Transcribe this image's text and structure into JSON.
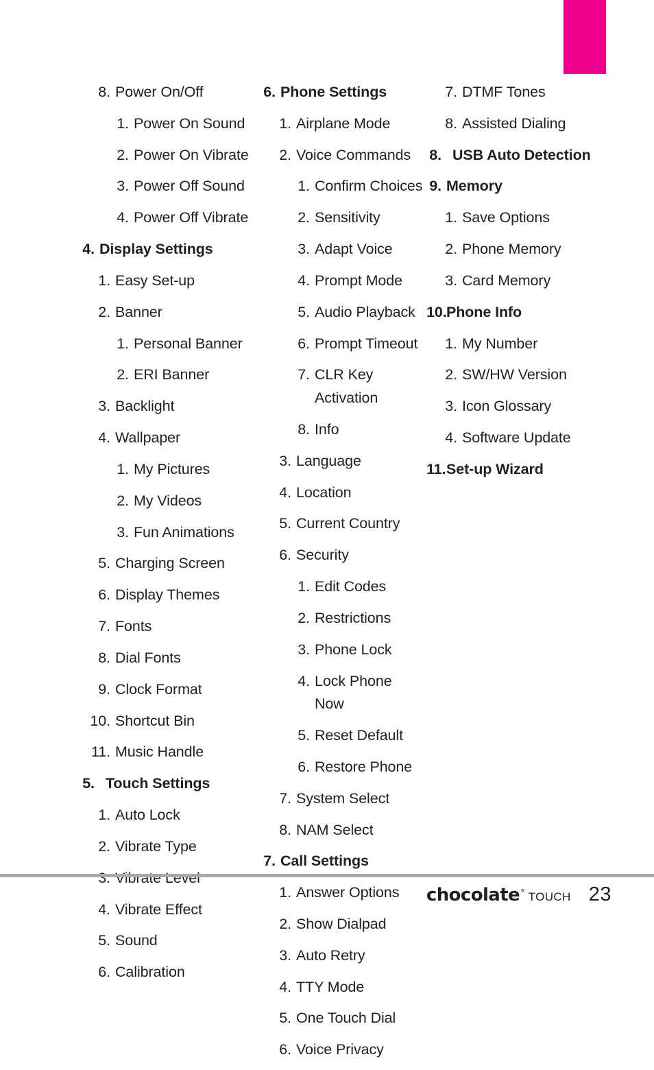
{
  "page": {
    "number": "23",
    "accent_color": "#ec008c",
    "rule_color": "#a7a9ac",
    "text_color": "#231f20"
  },
  "footer": {
    "logo_main": "chocolate",
    "logo_registered": "°",
    "logo_sub": "TOUCH",
    "page_number": "23"
  },
  "columns": [
    {
      "id": "col-1",
      "entries": [
        {
          "level": 2,
          "num": "8.",
          "text": "Power On/Off"
        },
        {
          "level": 3,
          "num": "1.",
          "text": "Power On Sound"
        },
        {
          "level": 3,
          "num": "2.",
          "text": "Power On Vibrate"
        },
        {
          "level": 3,
          "num": "3.",
          "text": "Power Off Sound"
        },
        {
          "level": 3,
          "num": "4.",
          "text": "Power Off Vibrate"
        },
        {
          "level": 1,
          "num": "4.",
          "text": "Display Settings"
        },
        {
          "level": 2,
          "num": "1.",
          "text": "Easy Set-up"
        },
        {
          "level": 2,
          "num": "2.",
          "text": "Banner"
        },
        {
          "level": 3,
          "num": "1.",
          "text": "Personal Banner"
        },
        {
          "level": 3,
          "num": "2.",
          "text": "ERI Banner"
        },
        {
          "level": 2,
          "num": "3.",
          "text": "Backlight"
        },
        {
          "level": 2,
          "num": "4.",
          "text": "Wallpaper"
        },
        {
          "level": 3,
          "num": "1.",
          "text": "My Pictures"
        },
        {
          "level": 3,
          "num": "2.",
          "text": "My Videos"
        },
        {
          "level": 3,
          "num": "3.",
          "text": "Fun Animations"
        },
        {
          "level": 2,
          "num": "5.",
          "text": "Charging Screen"
        },
        {
          "level": 2,
          "num": "6.",
          "text": "Display Themes"
        },
        {
          "level": 2,
          "num": "7.",
          "text": "Fonts"
        },
        {
          "level": 2,
          "num": "8.",
          "text": "Dial Fonts"
        },
        {
          "level": 2,
          "num": "9.",
          "text": "Clock Format"
        },
        {
          "level": 2,
          "num": "10.",
          "text": "Shortcut Bin"
        },
        {
          "level": 2,
          "num": "11.",
          "text": "Music Handle"
        },
        {
          "level": 1,
          "num": "5.",
          "text": "Touch Settings",
          "wide": true
        },
        {
          "level": 2,
          "num": "1.",
          "text": "Auto Lock"
        },
        {
          "level": 2,
          "num": "2.",
          "text": "Vibrate Type"
        },
        {
          "level": 2,
          "num": "3.",
          "text": "Vibrate Level"
        },
        {
          "level": 2,
          "num": "4.",
          "text": "Vibrate Effect"
        },
        {
          "level": 2,
          "num": "5.",
          "text": "Sound"
        },
        {
          "level": 2,
          "num": "6.",
          "text": "Calibration"
        }
      ]
    },
    {
      "id": "col-2",
      "entries": [
        {
          "level": 1,
          "num": "6.",
          "text": "Phone Settings"
        },
        {
          "level": 2,
          "num": "1.",
          "text": "Airplane Mode"
        },
        {
          "level": 2,
          "num": "2.",
          "text": "Voice Commands"
        },
        {
          "level": 3,
          "num": "1.",
          "text": "Confirm Choices"
        },
        {
          "level": 3,
          "num": "2.",
          "text": "Sensitivity"
        },
        {
          "level": 3,
          "num": "3.",
          "text": "Adapt Voice"
        },
        {
          "level": 3,
          "num": "4.",
          "text": "Prompt Mode"
        },
        {
          "level": 3,
          "num": "5.",
          "text": "Audio Playback"
        },
        {
          "level": 3,
          "num": "6.",
          "text": "Prompt Timeout"
        },
        {
          "level": 3,
          "num": "7.",
          "text": "CLR Key Activation"
        },
        {
          "level": 3,
          "num": "8.",
          "text": "Info"
        },
        {
          "level": 2,
          "num": "3.",
          "text": "Language"
        },
        {
          "level": 2,
          "num": "4.",
          "text": "Location"
        },
        {
          "level": 2,
          "num": "5.",
          "text": "Current Country"
        },
        {
          "level": 2,
          "num": "6.",
          "text": "Security"
        },
        {
          "level": 3,
          "num": "1.",
          "text": "Edit Codes"
        },
        {
          "level": 3,
          "num": "2.",
          "text": "Restrictions"
        },
        {
          "level": 3,
          "num": "3.",
          "text": "Phone Lock"
        },
        {
          "level": 3,
          "num": "4.",
          "text": "Lock Phone Now"
        },
        {
          "level": 3,
          "num": "5.",
          "text": "Reset Default"
        },
        {
          "level": 3,
          "num": "6.",
          "text": "Restore Phone"
        },
        {
          "level": 2,
          "num": "7.",
          "text": "System Select"
        },
        {
          "level": 2,
          "num": "8.",
          "text": "NAM Select"
        },
        {
          "level": 1,
          "num": "7.",
          "text": "Call Settings"
        },
        {
          "level": 2,
          "num": "1.",
          "text": "Answer Options"
        },
        {
          "level": 2,
          "num": "2.",
          "text": "Show Dialpad"
        },
        {
          "level": 2,
          "num": "3.",
          "text": "Auto Retry"
        },
        {
          "level": 2,
          "num": "4.",
          "text": "TTY Mode"
        },
        {
          "level": 2,
          "num": "5.",
          "text": "One Touch Dial"
        },
        {
          "level": 2,
          "num": "6.",
          "text": "Voice Privacy"
        }
      ]
    },
    {
      "id": "col-3",
      "entries": [
        {
          "level": 2,
          "num": "7.",
          "text": "DTMF Tones"
        },
        {
          "level": 2,
          "num": "8.",
          "text": "Assisted Dialing"
        },
        {
          "level": 1,
          "num": "8.",
          "text": "USB Auto Detection",
          "wide": true
        },
        {
          "level": 1,
          "num": "9.",
          "text": "Memory"
        },
        {
          "level": 2,
          "num": "1.",
          "text": "Save Options"
        },
        {
          "level": 2,
          "num": "2.",
          "text": "Phone Memory"
        },
        {
          "level": 2,
          "num": "3.",
          "text": "Card Memory"
        },
        {
          "level": 1,
          "num": "10.",
          "text": "Phone Info"
        },
        {
          "level": 2,
          "num": "1.",
          "text": "My Number"
        },
        {
          "level": 2,
          "num": "2.",
          "text": "SW/HW Version"
        },
        {
          "level": 2,
          "num": "3.",
          "text": "Icon Glossary"
        },
        {
          "level": 2,
          "num": "4.",
          "text": "Software Update"
        },
        {
          "level": 1,
          "num": "11.",
          "text": "Set-up Wizard"
        }
      ]
    }
  ]
}
